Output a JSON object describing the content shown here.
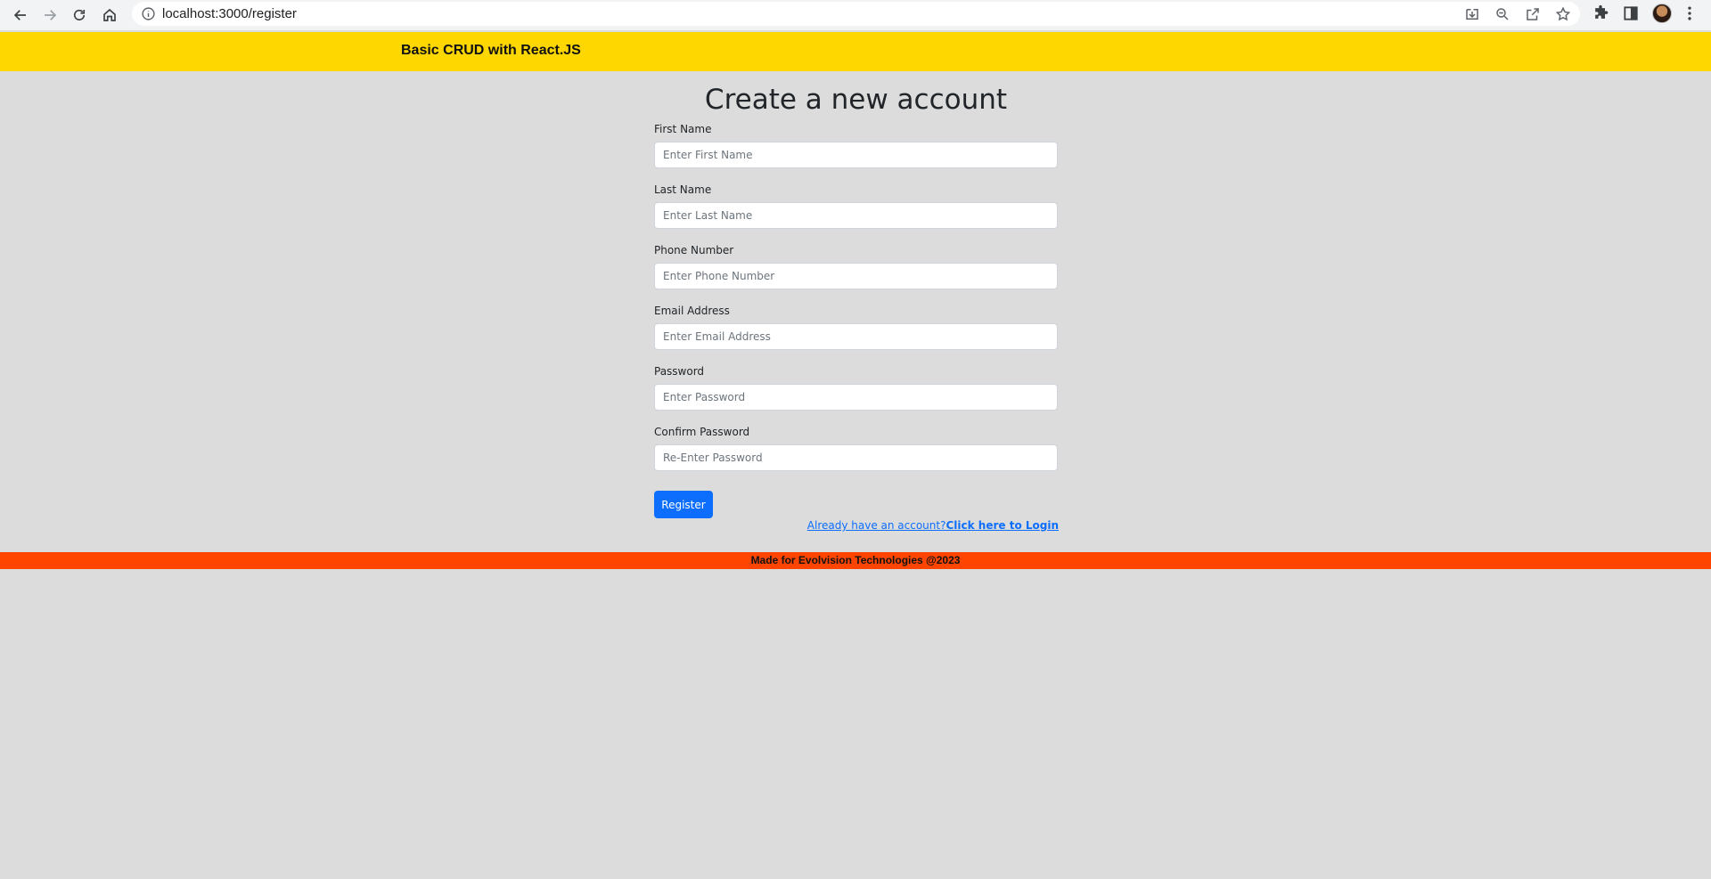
{
  "browser": {
    "url": "localhost:3000/register",
    "icons": [
      "back-arrow-icon",
      "forward-arrow-icon",
      "reload-icon",
      "home-icon",
      "info-icon",
      "install-icon",
      "zoom-icon",
      "share-icon",
      "star-icon",
      "extensions-icon",
      "side-panel-icon",
      "profile-avatar",
      "kebab-menu-icon"
    ]
  },
  "header": {
    "brand": "Basic CRUD with React.JS",
    "bg_color": "#ffd700"
  },
  "form": {
    "title": "Create a new account",
    "fields": [
      {
        "label": "First Name",
        "placeholder": "Enter First Name"
      },
      {
        "label": "Last Name",
        "placeholder": "Enter Last Name"
      },
      {
        "label": "Phone Number",
        "placeholder": "Enter Phone Number"
      },
      {
        "label": "Email Address",
        "placeholder": "Enter Email Address"
      },
      {
        "label": "Password",
        "placeholder": "Enter Password"
      },
      {
        "label": "Confirm Password",
        "placeholder": "Re-Enter Password"
      }
    ],
    "submit_label": "Register",
    "login_prompt": "Already have an account?",
    "login_link": "Click here to Login",
    "accent_color": "#0d6efd"
  },
  "footer": {
    "text": "Made for Evolvision Technologies @2023",
    "bg_color": "#ff4500"
  }
}
